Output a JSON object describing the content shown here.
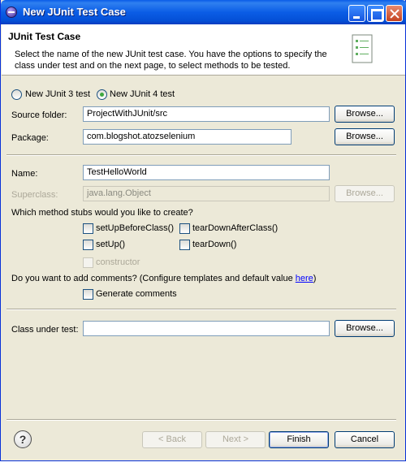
{
  "window": {
    "title": "New JUnit Test Case"
  },
  "header": {
    "title": "JUnit Test Case",
    "description": "Select the name of the new JUnit test case. You have the options to specify the class under test and on the next page, to select methods to be tested."
  },
  "radio": {
    "junit3": {
      "label": "New JUnit 3 test",
      "selected": false
    },
    "junit4": {
      "label": "New JUnit 4 test",
      "selected": true
    }
  },
  "form": {
    "source_folder": {
      "label": "Source folder:",
      "value": "ProjectWithJUnit/src",
      "browse": "Browse..."
    },
    "package": {
      "label": "Package:",
      "value": "com.blogshot.atozselenium",
      "browse": "Browse..."
    },
    "name": {
      "label": "Name:",
      "value": "TestHelloWorld"
    },
    "superclass": {
      "label": "Superclass:",
      "value": "java.lang.Object",
      "browse": "Browse..."
    },
    "class_under_test": {
      "label": "Class under test:",
      "value": "",
      "browse": "Browse..."
    }
  },
  "stubs": {
    "question": "Which method stubs would you like to create?",
    "setUpBeforeClass": "setUpBeforeClass()",
    "tearDownAfterClass": "tearDownAfterClass()",
    "setUp": "setUp()",
    "tearDown": "tearDown()",
    "constructor": "constructor"
  },
  "comments": {
    "question": "Do you want to add comments? (Configure templates and default value ",
    "link": "here",
    "close": ")",
    "generate": "Generate comments"
  },
  "buttons": {
    "back": "< Back",
    "next": "Next >",
    "finish": "Finish",
    "cancel": "Cancel"
  },
  "icons": {
    "help": "help-icon",
    "app": "eclipse-icon",
    "wizard": "junit-wizard-icon"
  },
  "colors": {
    "titlebar": "#0a5ce8",
    "dialog_bg": "#ece9d8",
    "radio_dot": "#3fa83f",
    "link": "#0000ff"
  }
}
